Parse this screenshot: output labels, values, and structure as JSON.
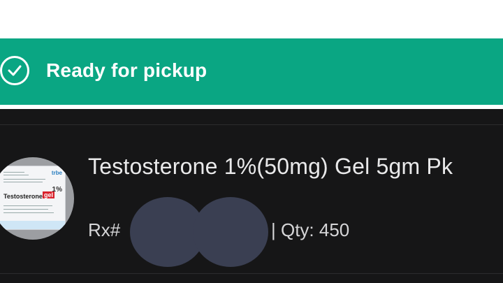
{
  "status": {
    "text": "Ready for pickup",
    "icon": "check-circle-icon",
    "color": "#0aa683"
  },
  "prescription": {
    "product_name": "Testosterone 1%(50mg) Gel 5gm Pk",
    "rx_label": "Rx#",
    "rx_number_redacted": true,
    "qty_text": "| Qty: 450",
    "thumbnail": {
      "brand": "trbe",
      "drug": "Testosterone",
      "form": "gel",
      "strength": "1%"
    }
  }
}
